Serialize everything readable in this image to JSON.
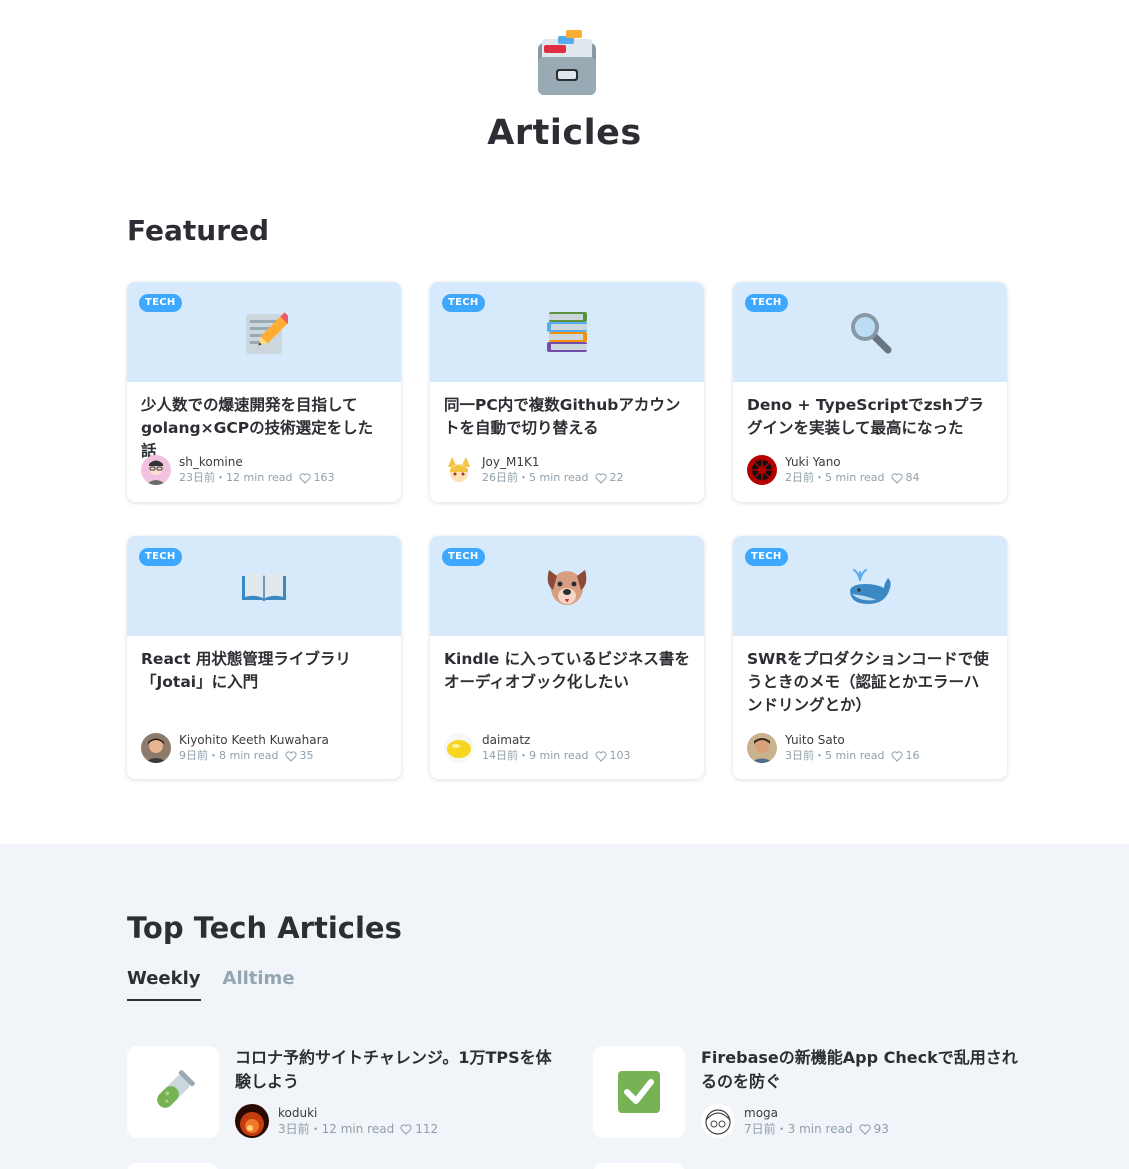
{
  "header": {
    "title": "Articles",
    "icon": "card-file-box-icon"
  },
  "featured": {
    "title": "Featured",
    "cards": [
      {
        "badge": "TECH",
        "icon": "memo-icon",
        "title": "少人数での爆速開発を目指して golang×GCPの技術選定をした話",
        "author": "sh_komine",
        "date": "23日前",
        "read": "12 min read",
        "likes": "163"
      },
      {
        "badge": "TECH",
        "icon": "books-icon",
        "title": "同一PC内で複数Githubアカウントを自動で切り替える",
        "author": "Joy_M1K1",
        "date": "26日前",
        "read": "5 min read",
        "likes": "22"
      },
      {
        "badge": "TECH",
        "icon": "magnifying-glass-icon",
        "title": "Deno + TypeScriptでzshプラグインを実装して最高になった",
        "author": "Yuki Yano",
        "date": "2日前",
        "read": "5 min read",
        "likes": "84"
      },
      {
        "badge": "TECH",
        "icon": "open-book-icon",
        "title": "React 用状態管理ライブラリ「Jotai」に入門",
        "author": "Kiyohito Keeth Kuwahara",
        "date": "9日前",
        "read": "8 min read",
        "likes": "35"
      },
      {
        "badge": "TECH",
        "icon": "dog-face-icon",
        "title": "Kindle に入っているビジネス書をオーディオブック化したい",
        "author": "daimatz",
        "date": "14日前",
        "read": "9 min read",
        "likes": "103"
      },
      {
        "badge": "TECH",
        "icon": "whale-icon",
        "title": "SWRをプロダクションコードで使うときのメモ（認証とかエラーハンドリングとか）",
        "author": "Yuito Sato",
        "date": "3日前",
        "read": "5 min read",
        "likes": "16"
      }
    ]
  },
  "top_tech": {
    "title": "Top Tech Articles",
    "tabs": [
      {
        "label": "Weekly",
        "active": true
      },
      {
        "label": "Alltime",
        "active": false
      }
    ],
    "items": [
      {
        "icon": "test-tube-icon",
        "title": "コロナ予約サイトチャレンジ。1万TPSを体験しよう",
        "author": "koduki",
        "date": "3日前",
        "read": "12 min read",
        "likes": "112"
      },
      {
        "icon": "check-mark-button-icon",
        "title": "Firebaseの新機能App Checkで乱用されるのを防ぐ",
        "author": "moga",
        "date": "7日前",
        "read": "3 min read",
        "likes": "93"
      }
    ]
  },
  "meta_separator": "・",
  "colors": {
    "accent": "#3ea8ff",
    "card_top": "#d7eafc",
    "section_bg": "#f1f4f8",
    "muted": "#8f9faa"
  }
}
